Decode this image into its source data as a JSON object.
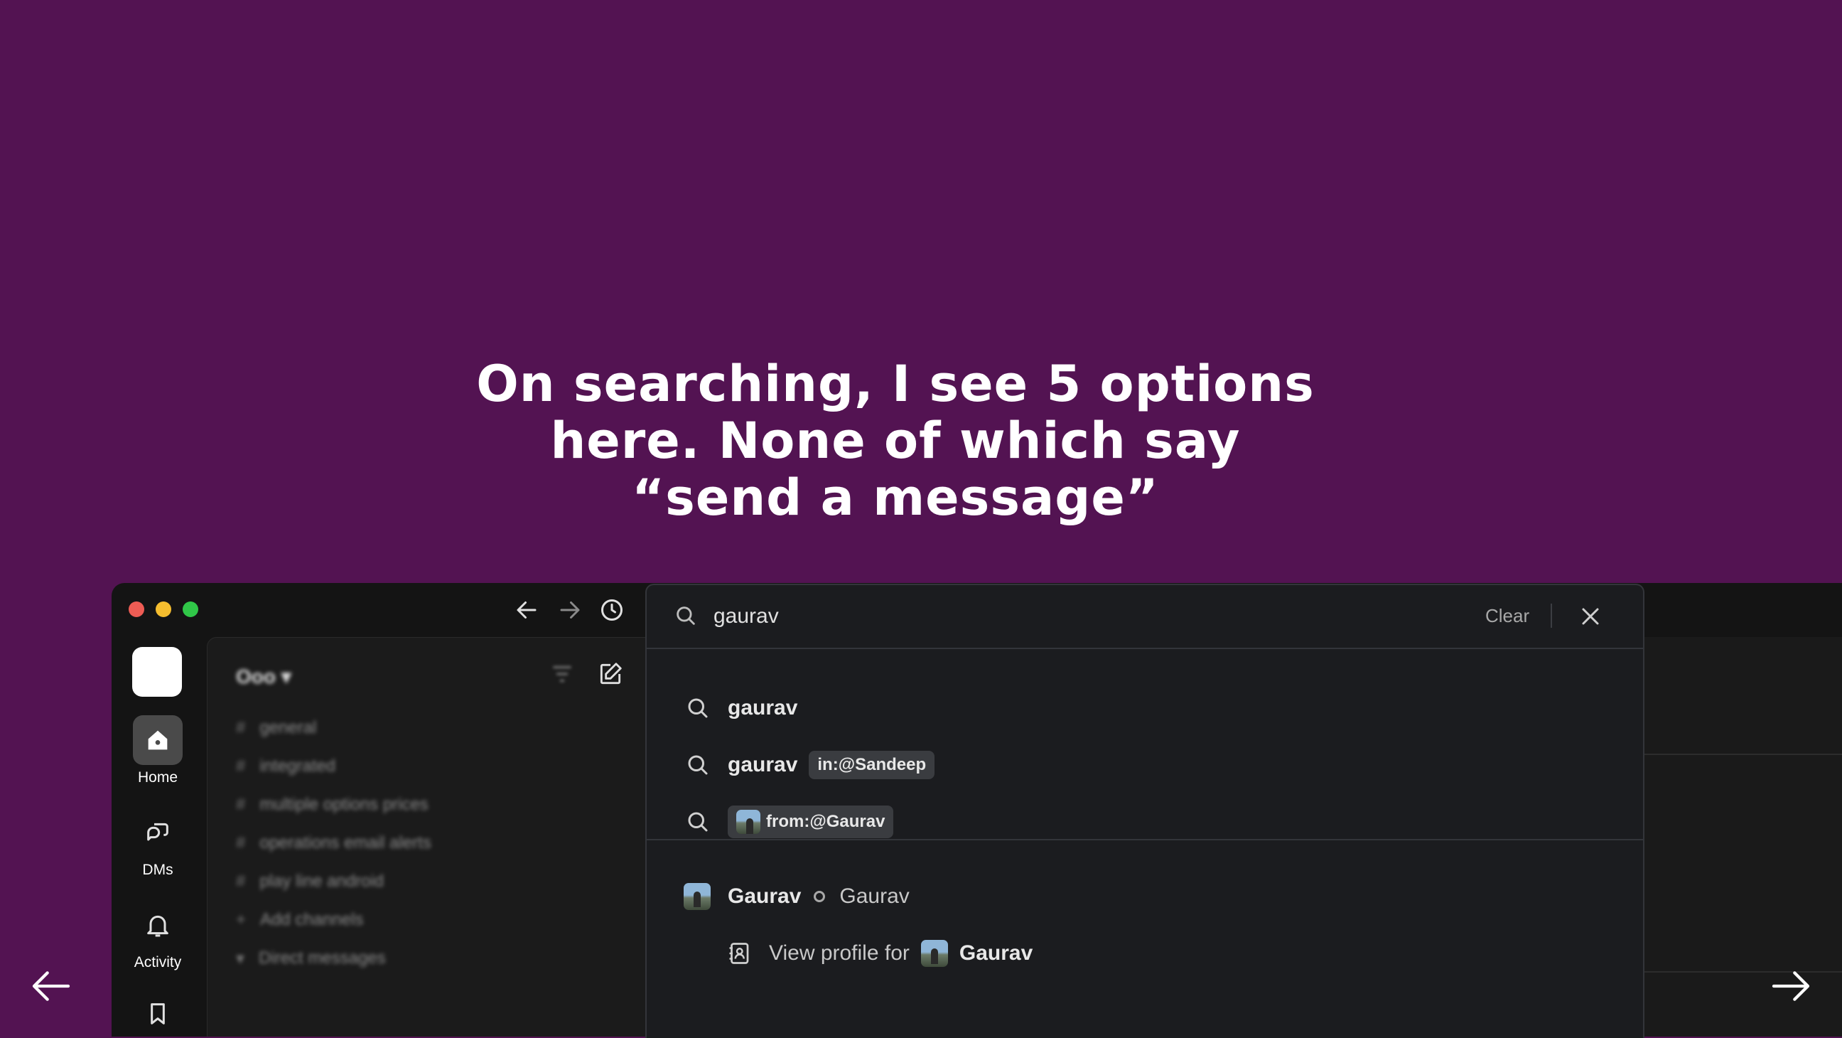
{
  "caption": {
    "line1": "On searching, I see 5 options",
    "line2": "here. None of which say",
    "line3": "“send a message”"
  },
  "colors": {
    "background": "#531352",
    "window": "#141414",
    "search_panel": "#1b1c1f",
    "accent_white": "#ffffff"
  },
  "nav": {
    "prev_icon": "arrow-left-icon",
    "next_icon": "arrow-right-icon"
  },
  "window": {
    "traffic_lights": [
      "#ee5c54",
      "#f5bd2f",
      "#30c748"
    ],
    "toolbar_icons": [
      "back-arrow-icon",
      "forward-arrow-icon",
      "history-clock-icon"
    ]
  },
  "rail": {
    "items": [
      {
        "label": "Home",
        "icon": "home-icon",
        "active": true
      },
      {
        "label": "DMs",
        "icon": "dms-icon"
      },
      {
        "label": "Activity",
        "icon": "bell-icon"
      },
      {
        "label": "",
        "icon": "bookmark-icon"
      }
    ]
  },
  "search": {
    "query": "gaurav",
    "clear_label": "Clear",
    "suggestions": [
      {
        "text": "gaurav"
      },
      {
        "text": "gaurav",
        "chip": "in:@Sandeep"
      },
      {
        "chip": "from:@Gaurav"
      }
    ],
    "person": {
      "name": "Gaurav",
      "status": "Gaurav"
    },
    "profile_action": {
      "label": "View profile for",
      "name": "Gaurav"
    }
  }
}
